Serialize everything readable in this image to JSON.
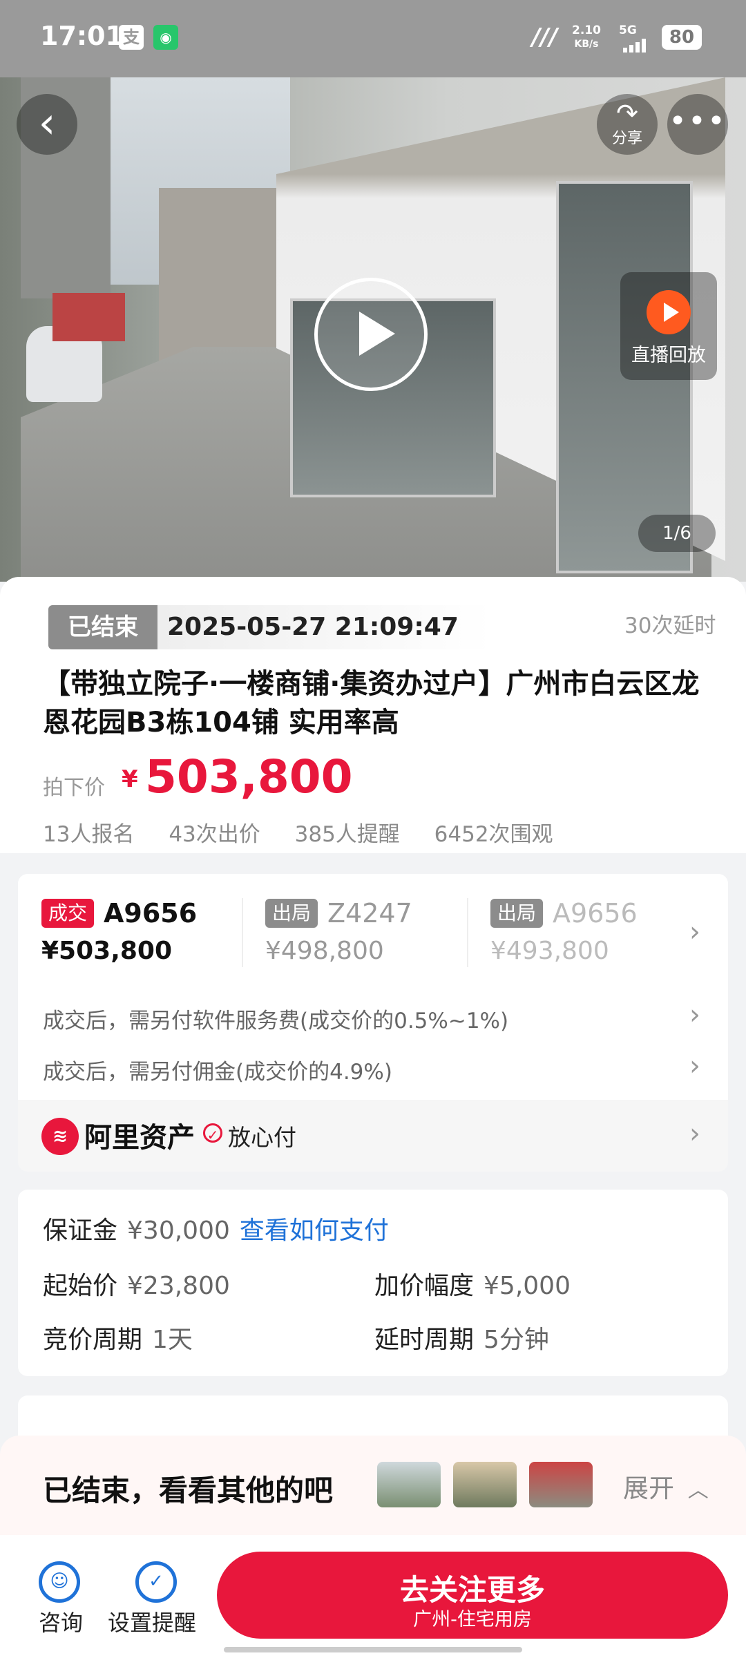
{
  "status_bar": {
    "time": "17:01",
    "app_icon_1": "支",
    "net_speed_value": "2.10",
    "net_speed_unit": "KB/s",
    "signal": "5G",
    "battery": "80"
  },
  "hero": {
    "share_label": "分享",
    "live_label": "直播回放",
    "counter": "1/6"
  },
  "auction": {
    "status": "已结束",
    "end_time": "2025-05-27 21:09:47",
    "extensions": "30次延时",
    "title": "【带独立院子·一楼商铺·集资办过户】广州市白云区龙恩花园B3栋104铺 实用率高",
    "price_label": "拍下价",
    "currency": "¥",
    "price": "503,800",
    "stats": [
      "13人报名",
      "43次出价",
      "385人提醒",
      "6452次围观"
    ]
  },
  "bids": [
    {
      "tag": "成交",
      "code": "A9656",
      "price": "¥503,800",
      "tag_color": "#e8173c"
    },
    {
      "tag": "出局",
      "code": "Z4247",
      "price": "¥498,800",
      "tag_color": "#8c8c8c"
    },
    {
      "tag": "出局",
      "code": "A9656",
      "price": "¥493,800",
      "tag_color": "#8c8c8c"
    }
  ],
  "fees": {
    "service": "成交后，需另付软件服务费(成交价的0.5%~1%)",
    "commission": "成交后，需另付佣金(成交价的4.9%)"
  },
  "ali": {
    "name": "阿里资产",
    "pay": "放心付"
  },
  "deposit": {
    "deposit_label": "保证金",
    "deposit_value": "¥30,000",
    "pay_link": "查看如何支付",
    "start_label": "起始价",
    "start_value": "¥23,800",
    "step_label": "加价幅度",
    "step_value": "¥5,000",
    "period_label": "竞价周期",
    "period_value": "1天",
    "delay_label": "延时周期",
    "delay_value": "5分钟"
  },
  "ended_banner": {
    "text": "已结束，看看其他的吧",
    "expand": "展开"
  },
  "bottom": {
    "consult": "咨询",
    "remind": "设置提醒",
    "cta_main": "去关注更多",
    "cta_sub": "广州-住宅用房"
  },
  "colors": {
    "accent": "#e8173c",
    "link": "#1f72d8"
  }
}
